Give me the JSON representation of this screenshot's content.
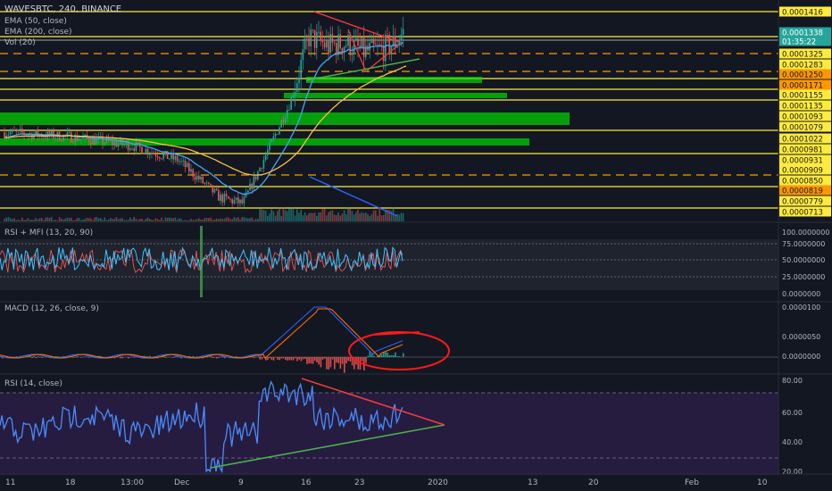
{
  "header": {
    "symbol_line": "WAVESBTC, 240, BINANCE",
    "indicators": [
      "EMA (50, close)",
      "EMA (200, close)",
      "Vol (20)"
    ]
  },
  "panes": {
    "rsi_mfi": "RSI + MFI (13, 20, 90)",
    "macd": "MACD (12, 26, close, 9)",
    "rsi": "RSI (14, close)"
  },
  "colors": {
    "background": "#131722",
    "up": "#26a69a",
    "down": "#ef5350",
    "level_line": "#ffeb3b",
    "zone": "#00e600",
    "ema50": "#42a5f5",
    "ema200": "#f7c046",
    "trend_green": "#4caf50",
    "trend_red": "#ef3b3b",
    "rsi_line": "#4a8cff",
    "price_tag_default": "#ffeb3b",
    "price_tag_orange": "#ff9800",
    "price_tag_current": "#26a69a"
  },
  "price_axis": {
    "labels": [
      {
        "text": "0.0001416",
        "style": "default"
      },
      {
        "text": "0.0001338",
        "style": "current"
      },
      {
        "text": "01:35:22",
        "style": "current"
      },
      {
        "text": "0.0001325",
        "style": "default"
      },
      {
        "text": "0.0001283",
        "style": "default"
      },
      {
        "text": "0.0001250",
        "style": "orange"
      },
      {
        "text": "0.0001171",
        "style": "orange"
      },
      {
        "text": "0.0001155",
        "style": "default"
      },
      {
        "text": "0.0001135",
        "style": "default"
      },
      {
        "text": "0.0001093",
        "style": "default"
      },
      {
        "text": "0.0001079",
        "style": "default"
      },
      {
        "text": "0.0001022",
        "style": "default"
      },
      {
        "text": "0.0000981",
        "style": "default"
      },
      {
        "text": "0.0000931",
        "style": "default"
      },
      {
        "text": "0.0000909",
        "style": "default"
      },
      {
        "text": "0.0000850",
        "style": "default"
      },
      {
        "text": "0.0000819",
        "style": "orange"
      },
      {
        "text": "0.0000779",
        "style": "default"
      },
      {
        "text": "0.0000713",
        "style": "default"
      }
    ],
    "rsi_mfi_ticks": [
      "100.0000000",
      "75.0000000",
      "50.0000000",
      "25.0000000",
      "0.0000000"
    ],
    "macd_ticks": [
      "0.0000100",
      "0.0000050",
      "0.0000000"
    ],
    "rsi_ticks": [
      "80.00",
      "60.00",
      "40.00",
      "20.00"
    ]
  },
  "time_axis": {
    "labels": [
      "11",
      "18",
      "13:00",
      "Dec",
      "9",
      "16",
      "23",
      "2020",
      "13",
      "20",
      "Feb",
      "10"
    ]
  },
  "chart_data": {
    "type": "candlestick",
    "symbol": "WAVESBTC",
    "interval": "240",
    "price_range": [
      7e-05,
      0.000143
    ],
    "price_path": [
      {
        "date": "Nov 11",
        "price": 0.0001
      },
      {
        "date": "Nov 18",
        "price": 9.85e-05
      },
      {
        "date": "Nov 25",
        "price": 9.55e-05
      },
      {
        "date": "Dec 2",
        "price": 9.05e-05
      },
      {
        "date": "Dec 6",
        "price": 7.8e-05
      },
      {
        "date": "Dec 9",
        "price": 7.6e-05
      },
      {
        "date": "Dec 12",
        "price": 9.5e-05
      },
      {
        "date": "Dec 14",
        "price": 0.00011
      },
      {
        "date": "Dec 16",
        "price": 0.000132
      },
      {
        "date": "Dec 18",
        "price": 0.000129
      },
      {
        "date": "Dec 20",
        "price": 0.00013
      },
      {
        "date": "Dec 22",
        "price": 0.000127
      },
      {
        "date": "Dec 24",
        "price": 0.000128
      },
      {
        "date": "Dec 26",
        "price": 0.00013
      },
      {
        "date": "Dec 27",
        "price": 0.0001338
      }
    ],
    "current_price": 0.0001338,
    "countdown": "01:35:22"
  }
}
